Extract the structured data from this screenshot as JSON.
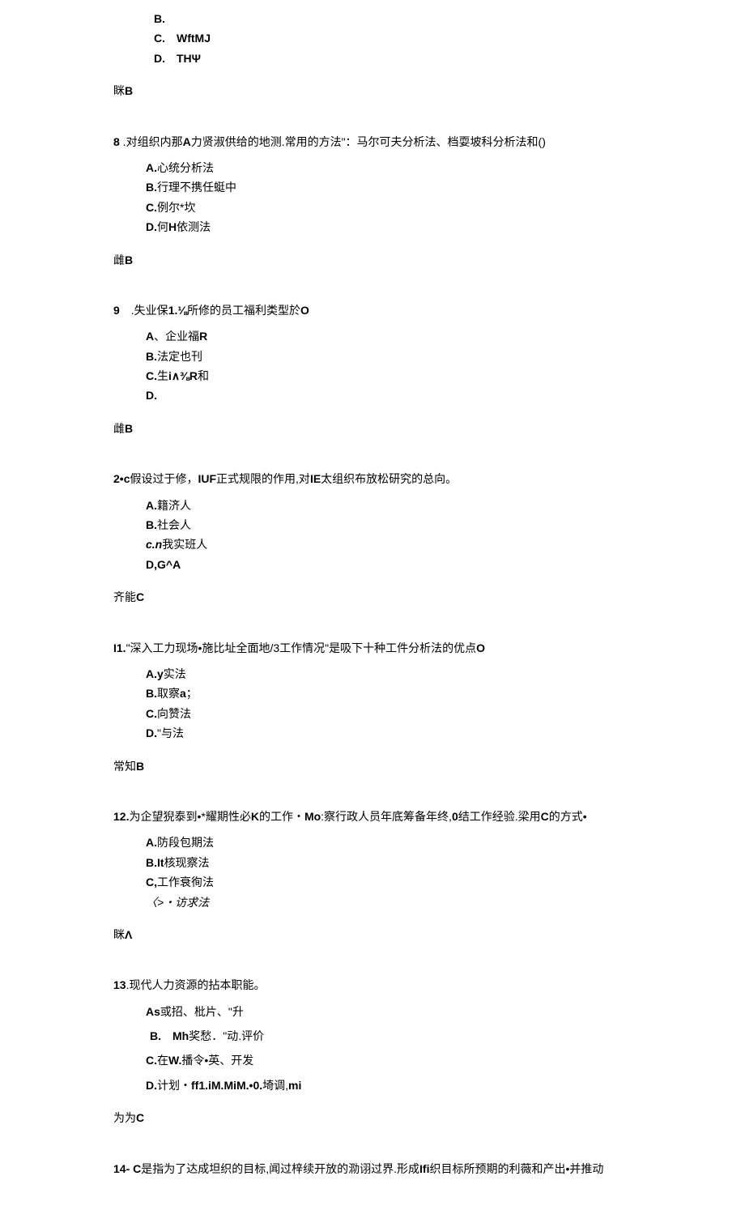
{
  "q7": {
    "options": {
      "b": "B.",
      "c": "C.　WftMJ",
      "d": "D.　THΨ"
    },
    "answer_prefix": "眯",
    "answer_bold": "B"
  },
  "q8": {
    "number": "8",
    "text_before": " .对组织内那",
    "bold1": "A",
    "text_mid": "力贤淑供给的地测.常用的方法\"：马尔可夫分析法、档耍坡科分析法和()",
    "options": {
      "a_bold": "A.",
      "a_text": "心统分析法",
      "b_bold": "B.",
      "b_text": "行理不携任蜓中",
      "c_bold": "C.",
      "c_text": "例尔*坎",
      "d_bold": "D.",
      "d_text": "何",
      "d_bold2": "H",
      "d_text2": "依测法"
    },
    "answer_prefix": "雌",
    "answer_bold": "B"
  },
  "q9": {
    "number": "9",
    "text": "　.失业保",
    "bold1": "1.⅛",
    "text2": "所修的员工福利类型於",
    "bold2": "O",
    "options": {
      "a_bold": "A",
      "a_text": "、企业福",
      "a_bold2": "R",
      "b_bold": "B.",
      "b_text": "法定也刊",
      "c_bold": "C.",
      "c_text": "生",
      "c_bold2": "i∧⅜R",
      "c_text2": "和",
      "d": "D."
    },
    "answer_prefix": "雌",
    "answer_bold": "B"
  },
  "q10": {
    "number_bold": "2•c",
    "text1": "假设过于修，",
    "bold1": "IUF",
    "text2": "正式规限的作用,对",
    "bold2": "IE",
    "text3": "太组织布放松研究的总向。",
    "options": {
      "a_bold": "A.",
      "a_text": "籍济人",
      "b_bold": "B.",
      "b_text": "社会人",
      "c_bold": "c.n",
      "c_text": "我实班人",
      "d": "D,G^A"
    },
    "answer_prefix": "齐能",
    "answer_bold": "C"
  },
  "q11": {
    "number": "I1.",
    "text1": "\"深入工力现场•施比址全面地/3工作情况\"是吸下十种工件分析法的优点",
    "bold1": "O",
    "options": {
      "a_bold": "A.y",
      "a_text": "实法",
      "b_bold": "B.",
      "b_text": "取察",
      "b_bold2": "a",
      "b_text2": "；",
      "c_bold": "C.",
      "c_text": "向赞法",
      "d_bold": "D.",
      "d_text": "\"与法"
    },
    "answer_prefix": "常知",
    "answer_bold": "B"
  },
  "q12": {
    "number": "12.",
    "text1": "为企望猊泰到•*耀期性必",
    "bold1": "K",
    "text2": "的工作・",
    "bold2": "Mo",
    "text3": ":察行政人员年底筹备年终,",
    "bold3": "0",
    "text4": "结工作经验.梁用",
    "bold4": "C",
    "text5": "的方式•",
    "options": {
      "a_bold": "A.",
      "a_text": "防段包期法",
      "b_bold": "B.It",
      "b_text": "核现察法",
      "c_bold": "C,",
      "c_text": "工作衰徇法",
      "d": "〈>・访求法"
    },
    "answer_prefix": "眯",
    "answer_bold": "Λ"
  },
  "q13": {
    "number": "13",
    "text": ".现代人力资源的拈本职能。",
    "options": {
      "a_bold": "As",
      "a_text": "或招、枇片、\"升",
      "b_bold": "B.　Mh",
      "b_text": "奖愁．\"动.评价",
      "c_bold": "C.",
      "c_text": "在",
      "c_bold2": "W.",
      "c_text2": "播令•英、开发",
      "d_bold": "D.",
      "d_text": "计划・",
      "d_bold2": "ff1.iM.MiM.•0.",
      "d_text2": "埼调,",
      "d_bold3": "mi"
    },
    "answer_prefix": "为为",
    "answer_bold": "C"
  },
  "q14": {
    "number": "14- C",
    "text1": "是指为了达成坦织的目标,闻过梓续开放的泐诩过界.形成",
    "bold1": "Ifi",
    "text2": "织目标所预期的利薇和产出•并推动"
  }
}
